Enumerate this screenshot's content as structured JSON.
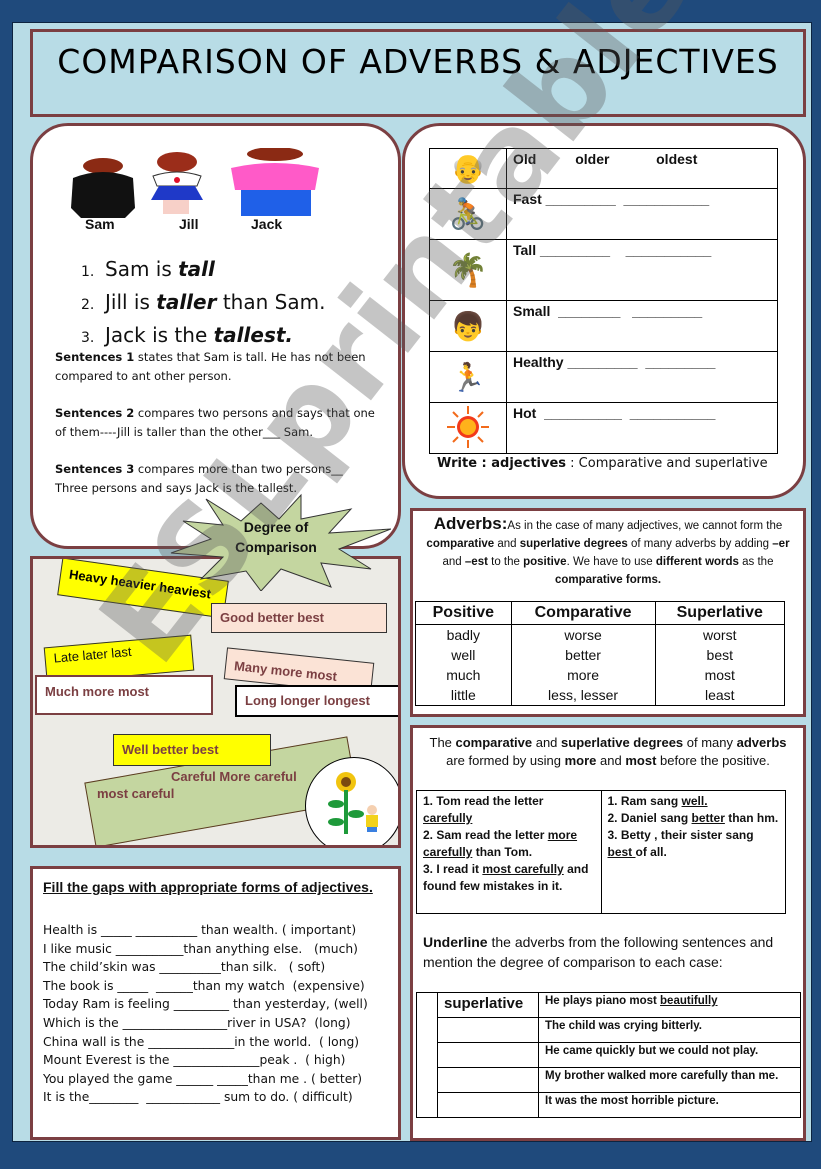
{
  "title": "COMPARISON OF ADVERBS & ADJECTIVES",
  "intro_panel": {
    "names": [
      "Sam",
      "Jill",
      "Jack"
    ],
    "sentences": [
      {
        "num": "1.",
        "pre": "Sam is ",
        "em": "tall",
        "post": ""
      },
      {
        "num": "2.",
        "pre": "Jill is ",
        "em": "taller",
        "post": " than Sam."
      },
      {
        "num": "3.",
        "pre": "Jack is the ",
        "em": "tallest.",
        "post": ""
      }
    ],
    "explanations": [
      {
        "bold": "Sentences 1",
        "text": " states that Sam is tall.  He has not been compared to ant other person."
      },
      {
        "bold": "Sentences 2",
        "text": " compares two persons and says that one of them----Jill is taller than the other___ Sam."
      },
      {
        "bold": "Sentences 3",
        "text": " compares more than two persons__ Three persons and says Jack is the tallest."
      }
    ]
  },
  "starburst": {
    "line1": "Degree of",
    "line2": "Comparison"
  },
  "word_tags": [
    {
      "text": "Heavy  heavier  heaviest"
    },
    {
      "text": "Good     better  best"
    },
    {
      "text": "Late later last"
    },
    {
      "text": "Many  more   most"
    },
    {
      "text": "Much    more    most"
    },
    {
      "text": "Long longer longest"
    },
    {
      "text": "Well   better   best"
    },
    {
      "text": "Careful  More careful"
    },
    {
      "text": "most careful"
    }
  ],
  "adjectives_table": {
    "rows": [
      {
        "icon": "old-man",
        "text": "Old          older            oldest"
      },
      {
        "icon": "cyclist",
        "text": "Fast _________  ___________"
      },
      {
        "icon": "tall-woman",
        "text": "Tall _________    ___________"
      },
      {
        "icon": "small-child",
        "text": "Small  ________   _________"
      },
      {
        "icon": "runner",
        "text": "Healthy _________  _________"
      },
      {
        "icon": "sun",
        "text": "Hot  __________  ___________"
      }
    ],
    "instruction_bold": "Write : adjectives",
    "instruction_text": " :  Comparative and superlative"
  },
  "adverbs_panel": {
    "heading": "Adverbs:",
    "intro_html_parts": [
      {
        "t": "As in the case of many adjectives, we cannot form the ",
        "b": false
      },
      {
        "t": "comparative",
        "b": true
      },
      {
        "t": " and ",
        "b": false
      },
      {
        "t": "superlative degrees",
        "b": true
      },
      {
        "t": " of many adverbs by adding ",
        "b": false
      },
      {
        "t": "–er",
        "b": true
      },
      {
        "t": " and ",
        "b": false
      },
      {
        "t": "–est",
        "b": true
      },
      {
        "t": " to the ",
        "b": false
      },
      {
        "t": "positive",
        "b": true
      },
      {
        "t": ". We have to use ",
        "b": false
      },
      {
        "t": "different words",
        "b": true
      },
      {
        "t": " as the ",
        "b": false
      },
      {
        "t": "comparative forms.",
        "b": true
      }
    ],
    "columns": [
      "Positive",
      "Comparative",
      "Superlative"
    ],
    "rows": [
      [
        "badly",
        "worse",
        "worst"
      ],
      [
        "well",
        "better",
        "best"
      ],
      [
        "much",
        "more",
        "most"
      ],
      [
        "little",
        "less, lesser",
        "least"
      ]
    ]
  },
  "more_most_panel": {
    "intro_parts": [
      {
        "t": "The ",
        "b": false
      },
      {
        "t": "comparative",
        "b": true
      },
      {
        "t": " and ",
        "b": false
      },
      {
        "t": "superlative degrees",
        "b": true
      },
      {
        "t": " of many ",
        "b": false
      },
      {
        "t": "adverbs",
        "b": true
      },
      {
        "t": " are formed by using  ",
        "b": false
      },
      {
        "t": "more",
        "b": true
      },
      {
        "t": " and ",
        "b": false
      },
      {
        "t": "most",
        "b": true
      },
      {
        "t": " before the positive.",
        "b": false
      }
    ],
    "left_examples": [
      {
        "pre": "1.  Tom read the letter ",
        "u": "carefully",
        "post": ""
      },
      {
        "pre": "2.  Sam read the letter ",
        "u": "more carefully",
        "post": " than Tom."
      },
      {
        "pre": "3.  I read it ",
        "u": "most  carefully",
        "post": " and found few mistakes in it."
      }
    ],
    "right_examples": [
      {
        "pre": " 1.  Ram sang ",
        "u": "well.",
        "post": ""
      },
      {
        "pre": "2.  Daniel sang ",
        "u": "better",
        "post": " than hm."
      },
      {
        "pre": "3.  Betty , their sister sang ",
        "u": "best ",
        "post": "of all."
      }
    ],
    "underline_bold": "Underline",
    "underline_text": " the adverbs from the following sentences and mention the degree of comparison to each case:",
    "degree_rows": [
      {
        "answer": "superlative",
        "pre": "He plays piano most ",
        "u": "beautifully",
        "post": ""
      },
      {
        "answer": "",
        "pre": "The child was crying bitterly.",
        "u": "",
        "post": ""
      },
      {
        "answer": "",
        "pre": "He came quickly but we could not play.",
        "u": "",
        "post": ""
      },
      {
        "answer": "",
        "pre": "My brother walked more carefully than me.",
        "u": "",
        "post": ""
      },
      {
        "answer": "",
        "pre": "It was the most horrible picture.",
        "u": "",
        "post": ""
      }
    ]
  },
  "fill_gaps": {
    "title": "Fill the gaps with appropriate forms of adjectives.",
    "lines": [
      "Health is _____ __________ than wealth. ( important)",
      "I like music ___________than anything else.   (much)",
      "The child’skin was __________than silk.   ( soft)",
      "The book is _____  ______than my watch  (expensive)",
      "Today Ram is feeling _________ than yesterday, (well)",
      "Which is the _________________river in USA?  (long)",
      "China wall is the ______________in the world.  ( long)",
      "Mount Everest is the ______________peak .  ( high)",
      "You played the game ______ _____than me . ( better)",
      "It is the________  ____________ sum to do. ( difficult)"
    ]
  },
  "watermark": "ESLprintables.com",
  "colors": {
    "frame": "#1f4a7c",
    "page": "#b8dce6",
    "panel_border": "#7b3f42",
    "tag_yellow": "#ffff00",
    "tag_peach": "#fbe3d6",
    "tag_green": "#c4d6a0",
    "tag_text": "#7b3f42"
  }
}
